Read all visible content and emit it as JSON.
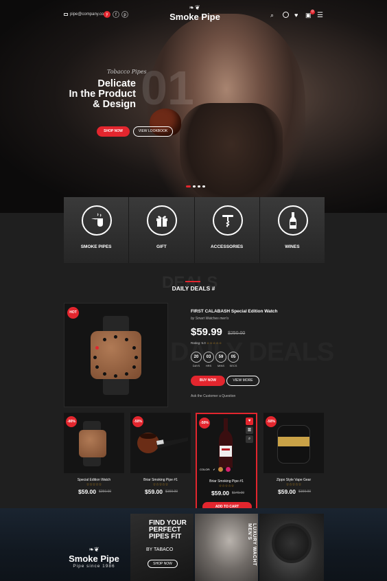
{
  "header": {
    "email": "pipe@company.com",
    "logo_name": "Smoke Pipe",
    "social": [
      "y",
      "f",
      "p"
    ],
    "cart_count": "0"
  },
  "hero": {
    "script_text": "Tobacco Pipes",
    "number": "01",
    "title_lines": [
      "Delicate",
      "In the Product",
      "& Design"
    ],
    "shop_now": "SHOP NOW",
    "view_lookbook": "VIEW LOOKBOOK"
  },
  "categories": [
    {
      "label": "SMOKE PIPES",
      "icon": "pipe-icon"
    },
    {
      "label": "GIFT",
      "icon": "gift-icon"
    },
    {
      "label": "ACCESSORIES",
      "icon": "corkscrew-icon"
    },
    {
      "label": "WINES",
      "icon": "wine-bottle-icon"
    }
  ],
  "deals": {
    "bg_text": "DEALS",
    "title": "DAILY DEALS #",
    "hot": "HOT",
    "product_title": "FIRST CALABASH Special Edition Watch",
    "by": "by Smart Watches men's",
    "price": "$59.99",
    "old_price": "$250.00",
    "rating_label": "Rating: 5.0",
    "countdown": [
      {
        "value": "20",
        "label": "DAYS"
      },
      {
        "value": "03",
        "label": "HRS"
      },
      {
        "value": "59",
        "label": "MINS"
      },
      {
        "value": "05",
        "label": "SECS"
      }
    ],
    "buy_now": "BUY NOW",
    "view_more": "VIEW MORE",
    "ask": "Ask the Customer a Question",
    "watermark": "DAILY DEALS"
  },
  "products": [
    {
      "discount": "-80%",
      "name": "Special Edition Watch",
      "price": "$59.00",
      "old_price": "$250.00"
    },
    {
      "discount": "-50%",
      "name": "Briar Smoking Pipe #1",
      "price": "$59.00",
      "old_price": "$159.00"
    },
    {
      "discount": "-50%",
      "name": "Briar Smoking Pipe #1",
      "price": "$59.00",
      "old_price": "$149.00",
      "color_label": "COLOR:",
      "add_to_cart": "ADD TO CART"
    },
    {
      "discount": "-50%",
      "name": "Zippo Style Vape Gear",
      "price": "$59.00",
      "old_price": "$159.00"
    }
  ],
  "colors": {
    "accent": "#e3262e",
    "star": "#e6a21b"
  },
  "banner": {
    "logo_name": "Smoke Pipe",
    "logo_sub": "Pipe since 1986",
    "find_lines": [
      "FIND YOUR",
      "PERFECT",
      "PIPES FIT"
    ],
    "by_tabaco": "BY TABACO",
    "shop_now": "SHOP NOW",
    "vertical_text": "LUXURY WACHT MEN'S"
  }
}
